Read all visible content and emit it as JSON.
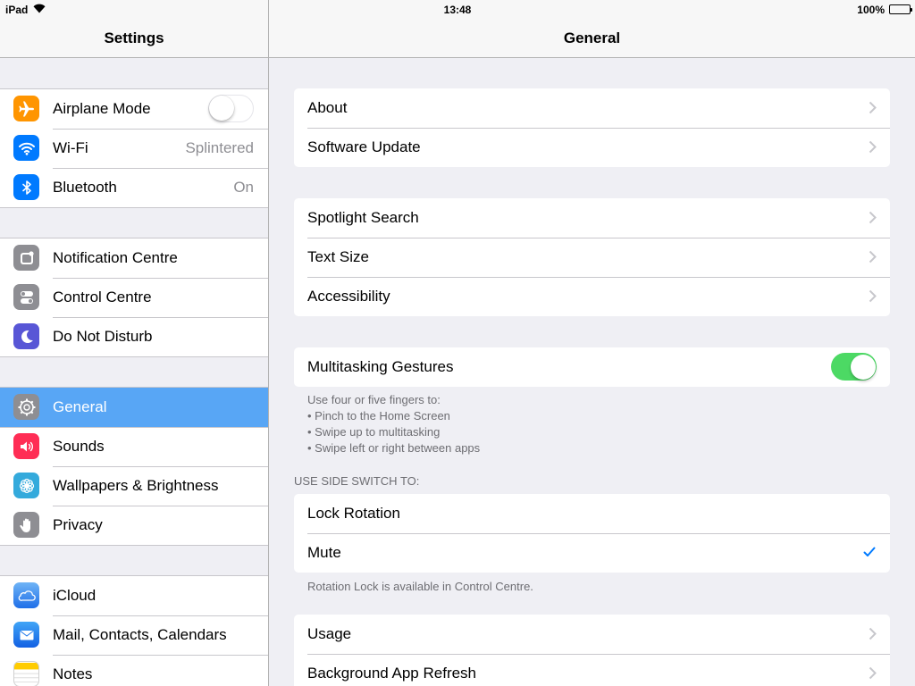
{
  "status_bar": {
    "device": "iPad",
    "time": "13:48",
    "battery": "100%"
  },
  "master": {
    "title": "Settings",
    "groups": [
      [
        {
          "label": "Airplane Mode",
          "icon": "airplane-icon",
          "color": "#ff9500",
          "toggle": false
        },
        {
          "label": "Wi-Fi",
          "icon": "wifi-icon",
          "color": "#007aff",
          "value": "Splintered"
        },
        {
          "label": "Bluetooth",
          "icon": "bluetooth-icon",
          "color": "#007aff",
          "value": "On"
        }
      ],
      [
        {
          "label": "Notification Centre",
          "icon": "notification-centre-icon",
          "color": "#8e8e93"
        },
        {
          "label": "Control Centre",
          "icon": "control-centre-icon",
          "color": "#8e8e93"
        },
        {
          "label": "Do Not Disturb",
          "icon": "moon-icon",
          "color": "#5856d6"
        }
      ],
      [
        {
          "label": "General",
          "icon": "gear-icon",
          "color": "#8e8e93",
          "selected": true
        },
        {
          "label": "Sounds",
          "icon": "speaker-icon",
          "color": "#ff2d55"
        },
        {
          "label": "Wallpapers & Brightness",
          "icon": "flower-icon",
          "color": "#34aadc"
        },
        {
          "label": "Privacy",
          "icon": "hand-icon",
          "color": "#8e8e93"
        }
      ],
      [
        {
          "label": "iCloud",
          "icon": "cloud-icon",
          "color": "#1f8ef1"
        },
        {
          "label": "Mail, Contacts, Calendars",
          "icon": "mail-icon",
          "color": "#1d77ec"
        },
        {
          "label": "Notes",
          "icon": "notes-icon",
          "color": "#ffcc00"
        }
      ]
    ]
  },
  "detail": {
    "title": "General",
    "group1": [
      "About",
      "Software Update"
    ],
    "group2": [
      "Spotlight Search",
      "Text Size",
      "Accessibility"
    ],
    "multitasking": {
      "label": "Multitasking Gestures",
      "on": true
    },
    "multitasking_footer": [
      "Use four or five fingers to:",
      "• Pinch to the Home Screen",
      "• Swipe up to multitasking",
      "• Swipe left or right between apps"
    ],
    "side_switch_header": "USE SIDE SWITCH TO:",
    "side_switch_options": [
      {
        "label": "Lock Rotation",
        "checked": false
      },
      {
        "label": "Mute",
        "checked": true
      }
    ],
    "side_switch_footer": "Rotation Lock is available in Control Centre.",
    "group5": [
      "Usage",
      "Background App Refresh"
    ]
  },
  "colors": {
    "selection": "#58a6f5",
    "toggle_on": "#4cd964",
    "checkmark": "#007aff",
    "chevron": "#c7c7cc"
  }
}
